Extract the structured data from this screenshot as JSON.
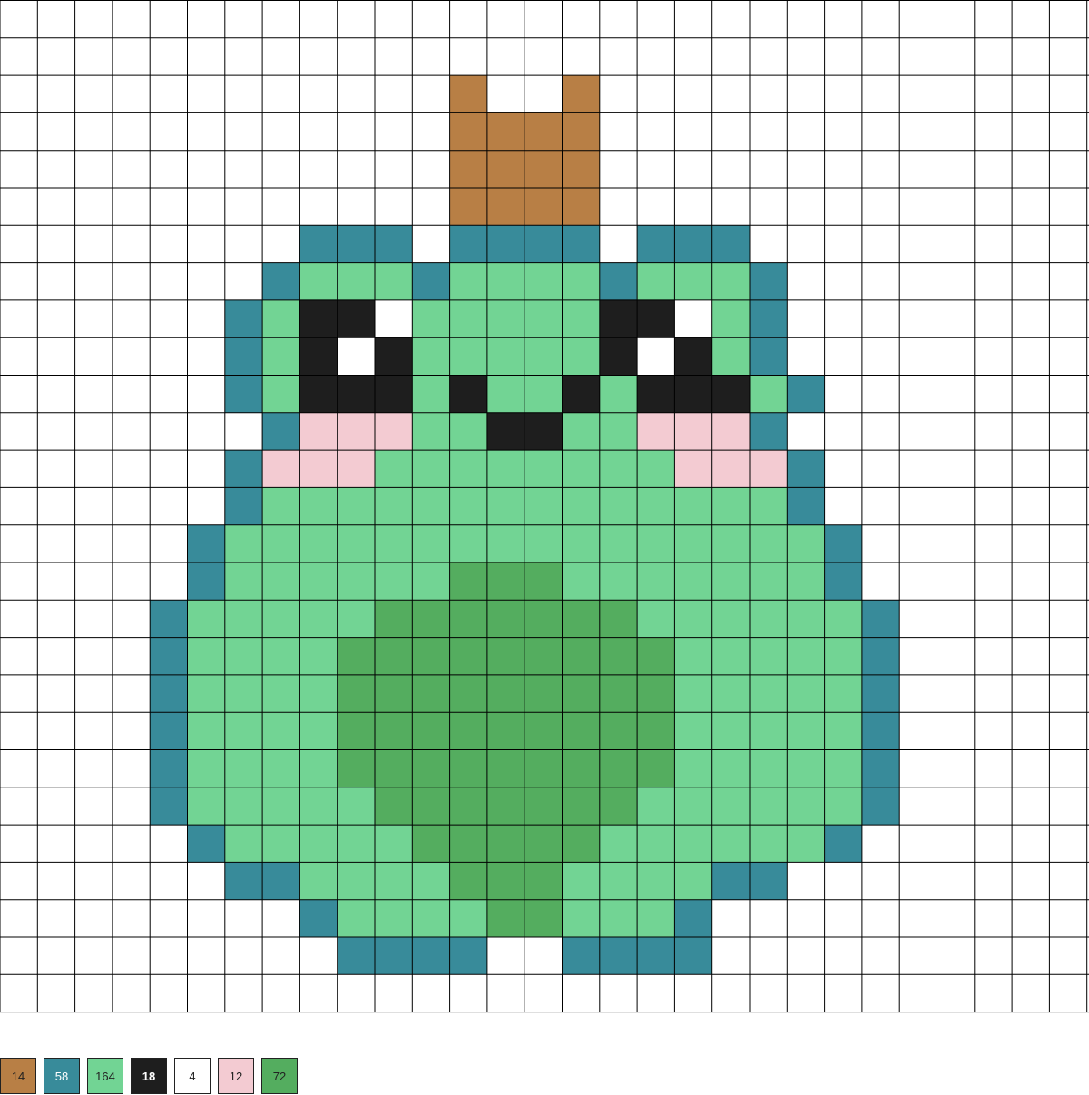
{
  "pattern": {
    "legend": {
      "B": "#b87f45",
      "T": "#388b9a",
      "L": "#72d494",
      "K": "#1e1e1e",
      "W": "#ffffff",
      "P": "#f3cbd2",
      "D": "#54ad5f"
    },
    "rows": [
      "..............................",
      "..............................",
      "............B..B..............",
      "............BBBB..............",
      "............BBBB..............",
      "............BBBB..............",
      "........TTT.TTTT.TTT..........",
      ".......TLLLTLLLLTLLLT.........",
      "......TLKKWLLLLLKKWLT.........",
      "......TLKWKLLLLLKWKLT.........",
      "......TLKKKLKLLKLKKKLT........",
      ".......TPPPLLKKLLPPPT.........",
      "......TPPPLLLLLLLLPPPT........",
      "......TLLLLLLLLLLLLLLT........",
      ".....TLLLLLLLLLLLLLLLLT.......",
      ".....TLLLLLLDDDLLLLLLLT.......",
      "....TLLLLLDDDDDDDLLLLLLT......",
      "....TLLLLDDDDDDDDDLLLLLT......",
      "....TLLLLDDDDDDDDDLLLLLT......",
      "....TLLLLDDDDDDDDDLLLLLT......",
      "....TLLLLDDDDDDDDDLLLLLT......",
      "....TLLLLLDDDDDDDLLLLLLT......",
      ".....TLLLLLDDDDDLLLLLLT.......",
      "......TTLLLLDDDLLLLTT.........",
      "........TLLLLDDLLLT...........",
      ".........TTTT..TTTT..........."
    ]
  },
  "palette": [
    {
      "code": "14",
      "color": "#b87f45",
      "text_color": "#222222"
    },
    {
      "code": "58",
      "color": "#388b9a",
      "text_color": "#ffffff"
    },
    {
      "code": "164",
      "color": "#72d494",
      "text_color": "#222222"
    },
    {
      "code": "18",
      "color": "#1e1e1e",
      "text_color": "#ffffff"
    },
    {
      "code": "4",
      "color": "#ffffff",
      "text_color": "#222222"
    },
    {
      "code": "12",
      "color": "#f3cbd2",
      "text_color": "#222222"
    },
    {
      "code": "72",
      "color": "#54ad5f",
      "text_color": "#222222"
    }
  ]
}
